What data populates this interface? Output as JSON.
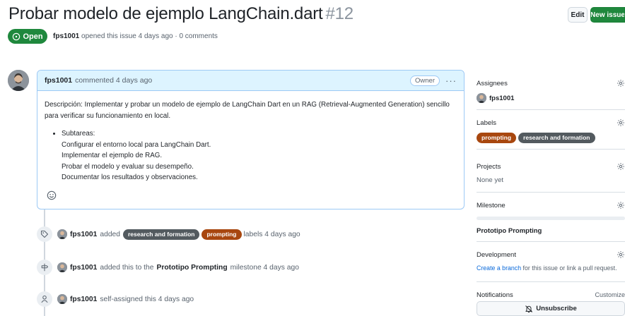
{
  "issue": {
    "title": "Probar modelo de ejemplo LangChain.dart",
    "number": "#12",
    "state": "Open",
    "author": "fps1001",
    "meta": "opened this issue 4 days ago · 0 comments"
  },
  "header_actions": {
    "edit_label": "Edit",
    "new_issue_label": "New issue"
  },
  "comment": {
    "author": "fps1001",
    "time": "commented 4 days ago",
    "role": "Owner",
    "description": "Descripción: Implementar y probar un modelo de ejemplo de LangChain Dart en un RAG (Retrieval-Augmented Generation) sencillo para verificar su funcionamiento en local.",
    "list_head": "Subtareas:",
    "subtasks": [
      "Configurar el entorno local para LangChain Dart.",
      "Implementar el ejemplo de RAG.",
      "Probar el modelo y evaluar su desempeño.",
      "Documentar los resultados y observaciones."
    ]
  },
  "timeline": [
    {
      "icon": "tag-icon",
      "actor": "fps1001",
      "pre": "added",
      "labels": [
        "research and formation",
        "prompting"
      ],
      "post": "labels 4 days ago"
    },
    {
      "icon": "milestone-icon",
      "actor": "fps1001",
      "pre": "added this to the",
      "milestone": "Prototipo Prompting",
      "post": "milestone 4 days ago"
    },
    {
      "icon": "person-icon",
      "actor": "fps1001",
      "pre": "self-assigned this 4 days ago"
    }
  ],
  "sidebar": {
    "assignees": {
      "title": "Assignees",
      "value": "fps1001"
    },
    "labels": {
      "title": "Labels",
      "items": [
        "prompting",
        "research and formation"
      ]
    },
    "projects": {
      "title": "Projects",
      "value": "None yet"
    },
    "milestone": {
      "title": "Milestone",
      "value": "Prototipo Prompting"
    },
    "development": {
      "title": "Development",
      "link": "Create a branch",
      "rest": "for this issue or link a pull request."
    },
    "notifications": {
      "title": "Notifications",
      "customize": "Customize",
      "unsubscribe": "Unsubscribe"
    }
  },
  "colors": {
    "open_green": "#1f883d",
    "label_research": "#535a5f",
    "label_prompting": "#a8470f",
    "link_blue": "#0969da"
  }
}
